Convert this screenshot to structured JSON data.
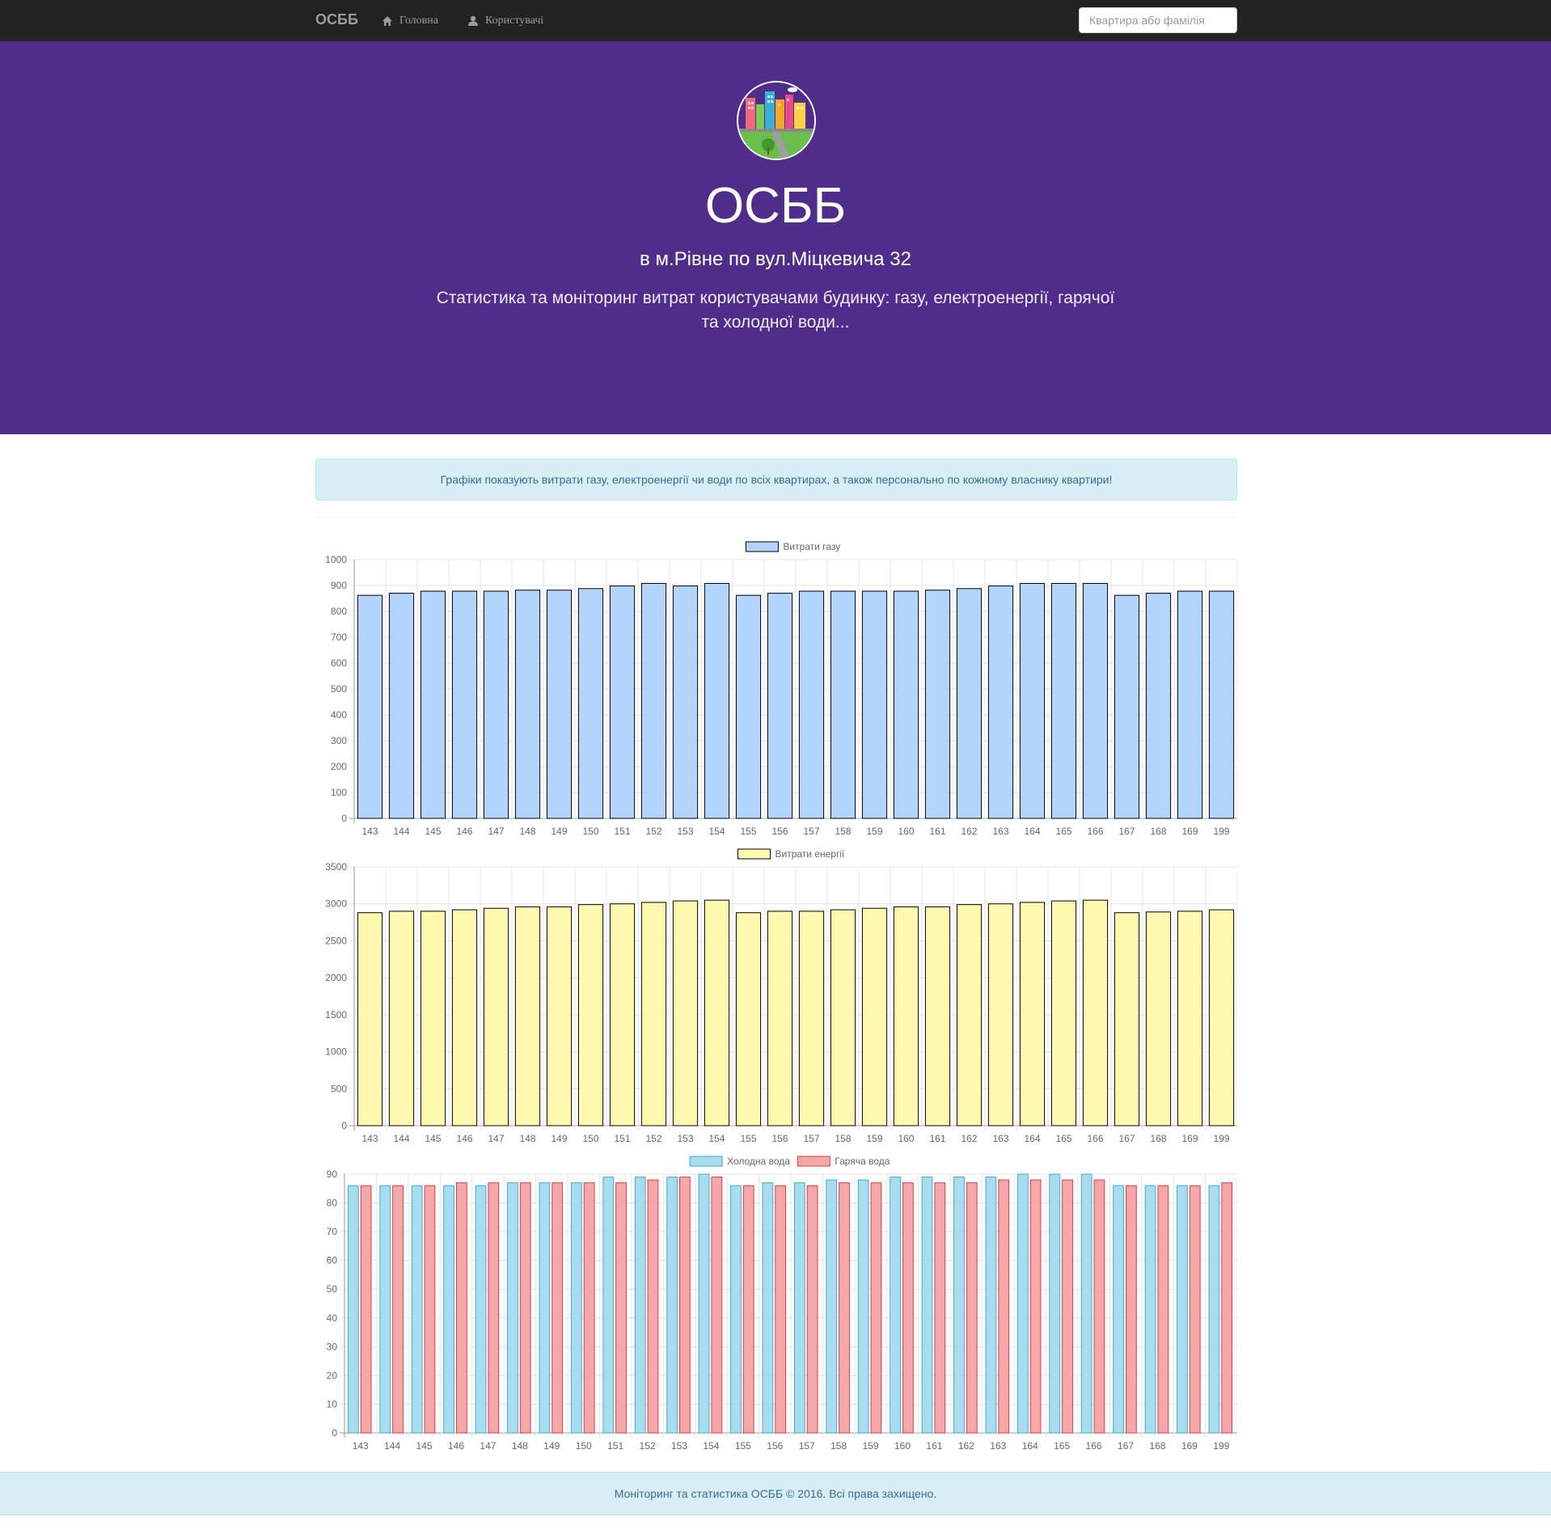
{
  "navbar": {
    "brand": "ОСББ",
    "links": [
      {
        "label": "Головна",
        "icon": "home-icon"
      },
      {
        "label": "Користувачі",
        "icon": "user-icon"
      }
    ],
    "search": {
      "placeholder": "Квартира або фамілія",
      "value": ""
    }
  },
  "hero": {
    "title": "ОСББ",
    "subtitle": "в м.Рівне по вул.Міцкевича 32",
    "description": "Статистика та моніторинг витрат користувачами будинку: газу, електроенергії, гарячої та холодної води..."
  },
  "alert": {
    "text": "Графіки показують витрати газу, електроенергії чи води по всіх квартирах, а також персонально по кожному власнику квартири!"
  },
  "chart_data": [
    {
      "type": "bar",
      "categories": [
        "143",
        "144",
        "145",
        "146",
        "147",
        "148",
        "149",
        "150",
        "151",
        "152",
        "153",
        "154",
        "155",
        "156",
        "157",
        "158",
        "159",
        "160",
        "161",
        "162",
        "163",
        "164",
        "165",
        "166",
        "167",
        "168",
        "169",
        "199"
      ],
      "series": [
        {
          "name": "Витрати газу",
          "color": "#b3d4fc",
          "border": "#000000",
          "values": [
            862,
            870,
            878,
            878,
            878,
            882,
            882,
            888,
            898,
            908,
            898,
            908,
            862,
            870,
            878,
            878,
            878,
            878,
            882,
            888,
            898,
            908,
            908,
            908,
            862,
            870,
            878,
            878
          ]
        }
      ],
      "ylim": [
        0,
        1000
      ],
      "yticks": [
        0,
        100,
        200,
        300,
        400,
        500,
        600,
        700,
        800,
        900,
        1000
      ],
      "legend": "top-center",
      "grid": true
    },
    {
      "type": "bar",
      "categories": [
        "143",
        "144",
        "145",
        "146",
        "147",
        "148",
        "149",
        "150",
        "151",
        "152",
        "153",
        "154",
        "155",
        "156",
        "157",
        "158",
        "159",
        "160",
        "161",
        "162",
        "163",
        "164",
        "165",
        "166",
        "167",
        "168",
        "169",
        "199"
      ],
      "series": [
        {
          "name": "Витрати енергії",
          "color": "#fff9b0",
          "border": "#000000",
          "values": [
            2880,
            2900,
            2900,
            2920,
            2940,
            2960,
            2960,
            2990,
            3000,
            3020,
            3040,
            3050,
            2880,
            2900,
            2900,
            2920,
            2940,
            2960,
            2960,
            2990,
            3000,
            3020,
            3040,
            3050,
            2880,
            2890,
            2900,
            2920
          ]
        }
      ],
      "ylim": [
        0,
        3500
      ],
      "yticks": [
        0,
        500,
        1000,
        1500,
        2000,
        2500,
        3000,
        3500
      ],
      "legend": "top-center",
      "grid": true
    },
    {
      "type": "bar",
      "categories": [
        "143",
        "144",
        "145",
        "146",
        "147",
        "148",
        "149",
        "150",
        "151",
        "152",
        "153",
        "154",
        "155",
        "156",
        "157",
        "158",
        "159",
        "160",
        "161",
        "162",
        "163",
        "164",
        "165",
        "166",
        "167",
        "168",
        "169",
        "199"
      ],
      "series": [
        {
          "name": "Холодна вода",
          "color": "#a8dcee",
          "border": "#3aaed6",
          "values": [
            86,
            86,
            86,
            86,
            86,
            87,
            87,
            87,
            89,
            89,
            89,
            90,
            86,
            87,
            87,
            88,
            88,
            89,
            89,
            89,
            89,
            90,
            90,
            90,
            86,
            86,
            86,
            86
          ]
        },
        {
          "name": "Гаряча вода",
          "color": "#f5a8aa",
          "border": "#e03a3e",
          "values": [
            86,
            86,
            86,
            87,
            87,
            87,
            87,
            87,
            87,
            88,
            89,
            89,
            86,
            86,
            86,
            87,
            87,
            87,
            87,
            87,
            88,
            88,
            88,
            88,
            86,
            86,
            86,
            87
          ]
        }
      ],
      "ylim": [
        0,
        90
      ],
      "yticks": [
        0,
        10,
        20,
        30,
        40,
        50,
        60,
        70,
        80,
        90
      ],
      "legend": "top-center",
      "grid": true
    }
  ],
  "footer": {
    "text": "Моніторинг та статистика ОСББ © 2016. Всі права захищено."
  }
}
